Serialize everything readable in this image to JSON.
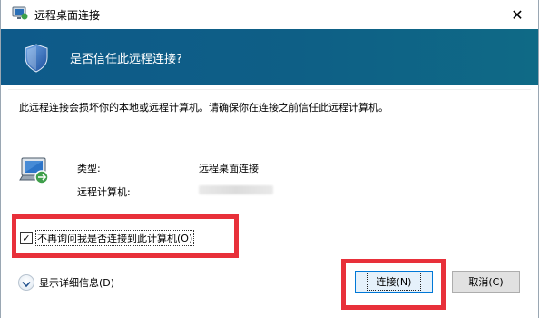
{
  "window": {
    "title": "远程桌面连接",
    "close_glyph": "✕"
  },
  "banner": {
    "text": "是否信任此远程连接?"
  },
  "message": "此远程连接会损坏你的本地或远程计算机。请确保你在连接之前信任此远程计算机。",
  "info": {
    "type_label": "类型:",
    "type_value": "远程桌面连接",
    "computer_label": "远程计算机:"
  },
  "checkbox": {
    "checked": true,
    "check_glyph": "✓",
    "label": "不再询问我是否连接到此计算机(O)"
  },
  "details_toggle": {
    "label": "显示详细信息(D)"
  },
  "buttons": {
    "connect": "连接(N)",
    "cancel": "取消(C)"
  },
  "background_glyph": "否",
  "colors": {
    "banner": "#0e5a8a",
    "highlight": "#e8303a",
    "primary_border": "#0078d7"
  },
  "icons": [
    "rdp-app-icon",
    "shield-icon",
    "rdp-computer-icon",
    "chevron-down-icon",
    "close-icon"
  ]
}
